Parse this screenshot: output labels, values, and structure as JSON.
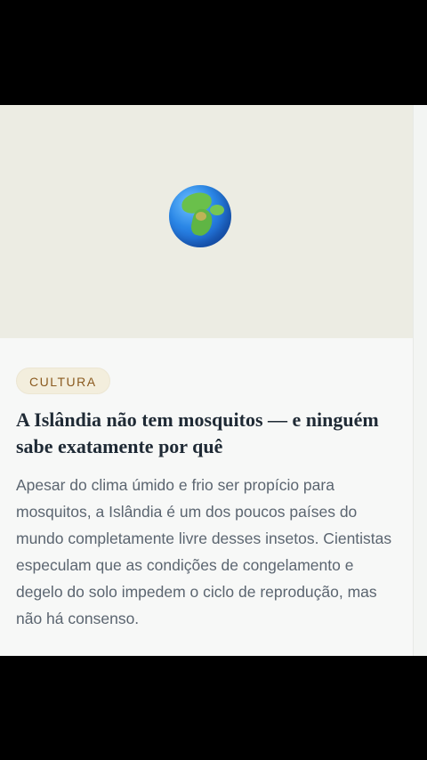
{
  "article_card": {
    "image": {
      "icon": "globe-earth-africa-europe",
      "background_color": "#ecece3"
    },
    "category": "CULTURA",
    "title": "A Islândia não tem mosquitos — e ninguém sabe exatamente por quê",
    "excerpt": "Apesar do clima úmido e frio ser propício para mosquitos, a Islândia é um dos poucos países do mundo completamente livre desses insetos. Cientistas especulam que as condições de congelamento e degelo do solo impedem o ciclo de reprodução, mas não há consenso."
  },
  "colors": {
    "background": "#000000",
    "card": "#f7f8f7",
    "category_text": "#8a5a1f",
    "category_pill": "#f3eedd",
    "title_text": "#1f2a35",
    "body_text": "#5b6570"
  }
}
